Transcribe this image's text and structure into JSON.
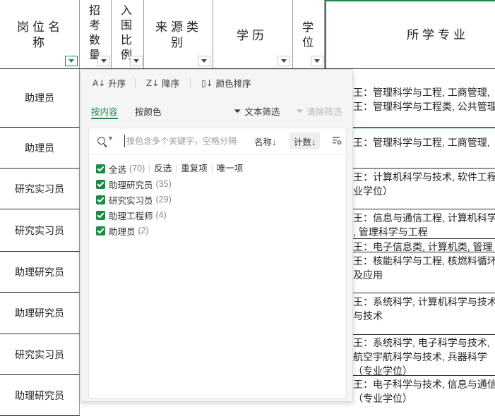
{
  "header": {
    "col_position": "岗位名称",
    "col_recruit": "招考数量",
    "col_ratio": "入围比例",
    "col_source": "来源类别",
    "col_education": "学历",
    "col_degree": "学位",
    "col_major": "所学专业"
  },
  "rows": [
    {
      "label": "助理员"
    },
    {
      "label": "助理员"
    },
    {
      "label": "研究实习员"
    },
    {
      "label": "研究实习员"
    },
    {
      "label": "助理研究员"
    },
    {
      "label": "助理研究员"
    },
    {
      "label": "研究实习员"
    },
    {
      "label": "助理研究员"
    }
  ],
  "major_lines": [
    "王：管理科学与工程, 工商管理,",
    "王：管理科学与工程类, 公共管理",
    "王：管理科学与工程, 工商管理,",
    "王：计算机科学与技术, 软件工程",
    "业学位）",
    "王：信息与通信工程, 计算机科学",
    ", 管理科学与工程",
    "王：电子信息类, 计算机类, 管理",
    "王：核能科学与工程, 核燃料循环",
    "及应用",
    "王：系统科学, 计算机科学与技术",
    "与技术",
    "王：系统科学, 电子科学与技术,",
    "航空宇航科学与技术, 兵器科学",
    "（专业学位）",
    "王：电子科学与技术, 信息与通信",
    "（专业学位）"
  ],
  "panel": {
    "sort_asc": "升序",
    "sort_desc": "降序",
    "sort_color": "颜色排序",
    "tab_content": "按内容",
    "tab_color": "按颜色",
    "text_filter": "文本筛选",
    "clear_filter": "清除筛选",
    "search_placeholder": "搜包含多个关键字，空格分隔",
    "sort_by_name": "名称↓",
    "sort_by_count": "计数↓",
    "select_all": "全选",
    "select_all_count": "(70)",
    "invert": "反选",
    "duplicates": "重复项",
    "unique": "唯一项",
    "items": [
      {
        "label": "助理研究员",
        "count": "(35)"
      },
      {
        "label": "研究实习员",
        "count": "(29)"
      },
      {
        "label": "助理工程师",
        "count": "(4)"
      },
      {
        "label": "助理员",
        "count": "(2)"
      }
    ]
  },
  "colors": {
    "accent": "#1d8a4a",
    "panel_bg": "#f4f5f5"
  }
}
